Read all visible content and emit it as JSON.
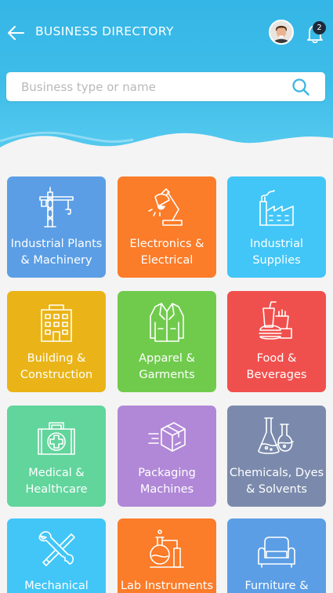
{
  "header": {
    "title": "BUSINESS DIRECTORY",
    "notification_count": "2"
  },
  "search": {
    "placeholder": "Business type or name"
  },
  "categories": [
    {
      "label": "Industrial Plants & Machinery",
      "color": "#5b9ee5",
      "icon": "crane-icon"
    },
    {
      "label": "Electronics & Electrical",
      "color": "#fb7c29",
      "icon": "desk-lamp-icon"
    },
    {
      "label": "Industrial Supplies",
      "color": "#42c6f7",
      "icon": "factory-icon"
    },
    {
      "label": "Building & Construction",
      "color": "#eab418",
      "icon": "building-icon"
    },
    {
      "label": "Apparel & Garments",
      "color": "#70cb4d",
      "icon": "jacket-icon"
    },
    {
      "label": "Food & Beverages",
      "color": "#f0504d",
      "icon": "fast-food-icon"
    },
    {
      "label": "Medical & Healthcare",
      "color": "#61d59c",
      "icon": "first-aid-kit-icon"
    },
    {
      "label": "Packaging Machines",
      "color": "#b188d7",
      "icon": "package-box-icon"
    },
    {
      "label": "Chemicals, Dyes & Solvents",
      "color": "#7b8aac",
      "icon": "flasks-icon"
    },
    {
      "label": "Mechanical Parts",
      "color": "#42c6f7",
      "icon": "wrenches-icon"
    },
    {
      "label": "Lab Instruments",
      "color": "#fb7c29",
      "icon": "lab-equipment-icon"
    },
    {
      "label": "Furniture &",
      "color": "#5b9ee5",
      "icon": "sofa-icon"
    }
  ]
}
